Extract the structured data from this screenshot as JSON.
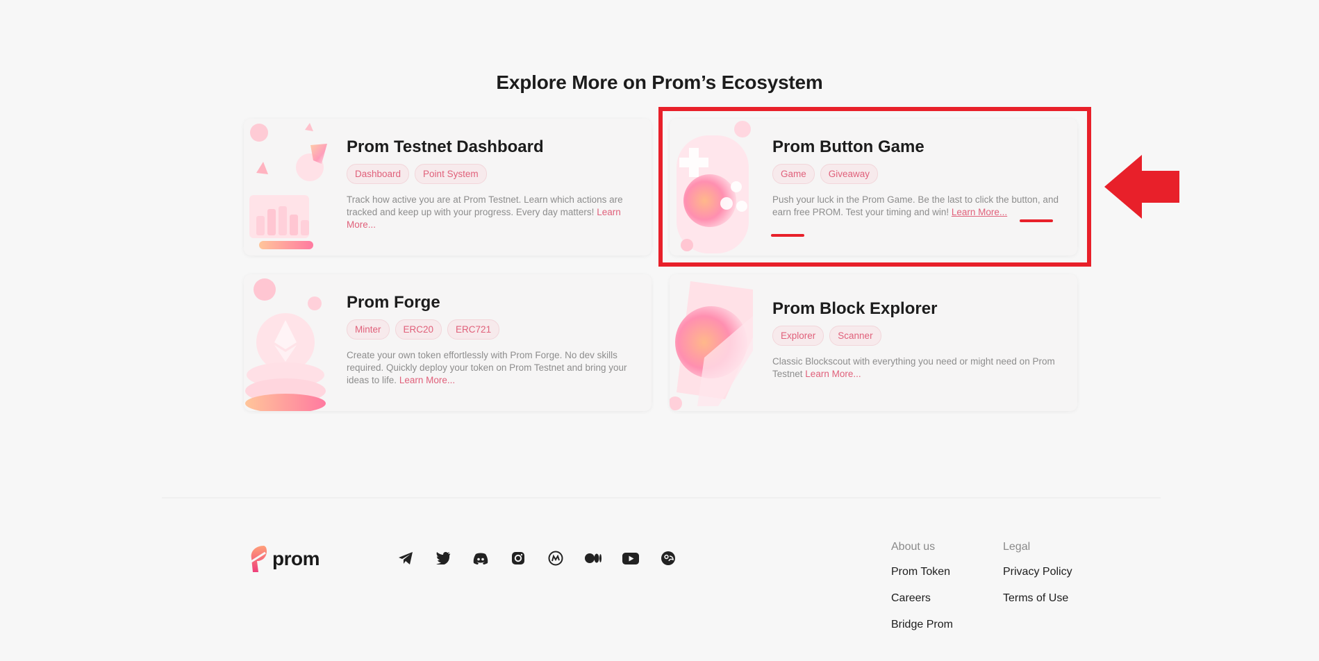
{
  "section": {
    "title": "Explore More on Prom’s Ecosystem"
  },
  "cards": [
    {
      "title": "Prom Testnet Dashboard",
      "tags": [
        "Dashboard",
        "Point System"
      ],
      "description": "Track how active you are at Prom Testnet. Learn which actions are tracked and keep up with your progress. Every day matters!",
      "link": "Learn More..."
    },
    {
      "title": "Prom Button Game",
      "tags": [
        "Game",
        "Giveaway"
      ],
      "description": "Push your luck in the Prom Game. Be the last to click the button, and earn free PROM. Test your timing and win!",
      "link": "Learn More..."
    },
    {
      "title": "Prom Forge",
      "tags": [
        "Minter",
        "ERC20",
        "ERC721"
      ],
      "description": "Create your own token effortlessly with Prom Forge. No dev skills required. Quickly deploy your token on Prom Testnet and bring your ideas to life.",
      "link": "Learn More..."
    },
    {
      "title": "Prom Block Explorer",
      "tags": [
        "Explorer",
        "Scanner"
      ],
      "description": "Classic Blockscout with everything you need or might need on Prom Testnet",
      "link": "Learn More..."
    }
  ],
  "footer": {
    "logo": "prom",
    "socials": [
      "telegram-icon",
      "twitter-icon",
      "discord-icon",
      "instagram-icon",
      "coinmarketcap-icon",
      "medium-icon",
      "youtube-icon",
      "coingecko-icon"
    ],
    "about": {
      "heading": "About us",
      "links": [
        "Prom Token",
        "Careers",
        "Bridge Prom"
      ]
    },
    "legal": {
      "heading": "Legal",
      "links": [
        "Privacy Policy",
        "Terms of Use"
      ]
    }
  },
  "colors": {
    "accent": "#e0607a",
    "annotation": "#e8202a",
    "background": "#f7f7f7"
  }
}
